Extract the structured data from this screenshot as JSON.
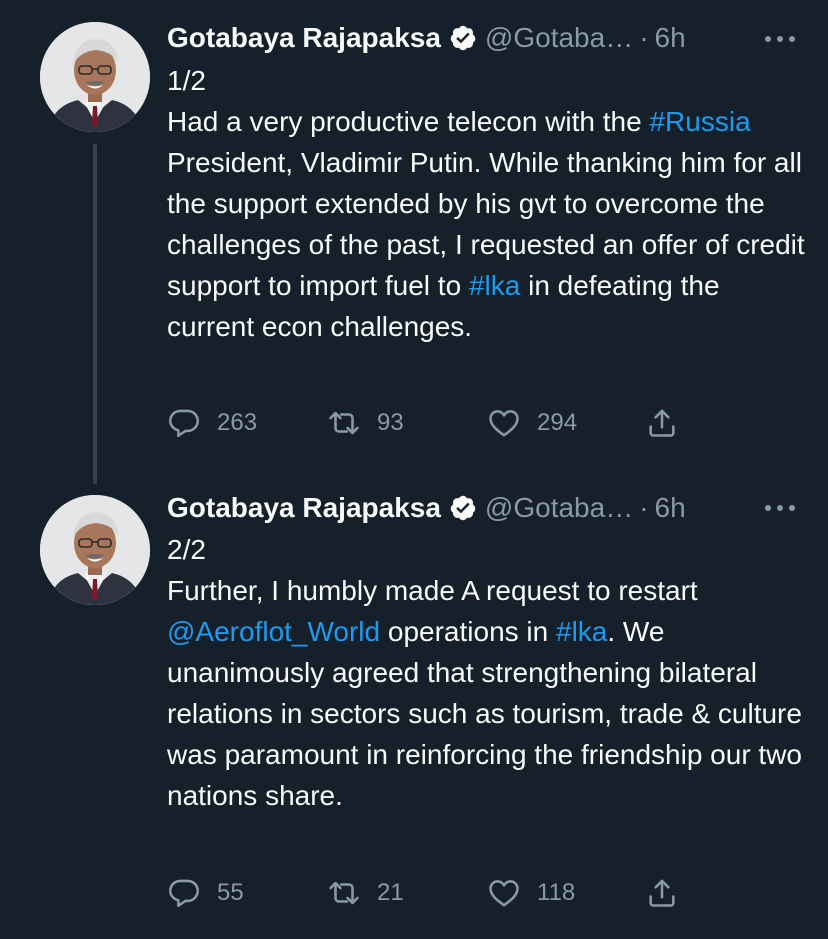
{
  "colors": {
    "background": "#15202b",
    "text_primary": "#f7f9f9",
    "text_secondary": "#8b98a5",
    "link": "#1d9bf0",
    "thread_line": "#38444d"
  },
  "tweets": [
    {
      "author_name": "Gotabaya Rajapaksa",
      "handle": "@Gotaba…",
      "separator": "·",
      "time": "6h",
      "verified_icon": "verified-badge-icon",
      "more_icon": "more-options-icon",
      "body": {
        "line_1": "1/2",
        "seg_1": "Had a very productive telecon with the ",
        "link_1": "#Russia",
        "seg_2": " President, Vladimir Putin. While thanking him for all the support extended by his gvt to overcome the challenges of the past, I requested an offer of credit support to import fuel to ",
        "link_2": "#lka",
        "seg_3": " in defeating the current econ challenges."
      },
      "actions": {
        "replies": "263",
        "retweets": "93",
        "likes": "294",
        "reply_icon": "reply-icon",
        "retweet_icon": "retweet-icon",
        "like_icon": "heart-icon",
        "share_icon": "share-icon"
      }
    },
    {
      "author_name": "Gotabaya Rajapaksa",
      "handle": "@Gotaba…",
      "separator": "·",
      "time": "6h",
      "verified_icon": "verified-badge-icon",
      "more_icon": "more-options-icon",
      "body": {
        "line_1": "2/2",
        "seg_1": "Further, I humbly made A request to restart ",
        "link_1": "@Aeroflot_World",
        "seg_2": " operations in ",
        "link_2": "#lka",
        "seg_3": ". We unanimously agreed that strengthening bilateral relations in sectors such as tourism, trade & culture was paramount in reinforcing the friendship our two nations share."
      },
      "actions": {
        "replies": "55",
        "retweets": "21",
        "likes": "118",
        "reply_icon": "reply-icon",
        "retweet_icon": "retweet-icon",
        "like_icon": "heart-icon",
        "share_icon": "share-icon"
      }
    }
  ]
}
